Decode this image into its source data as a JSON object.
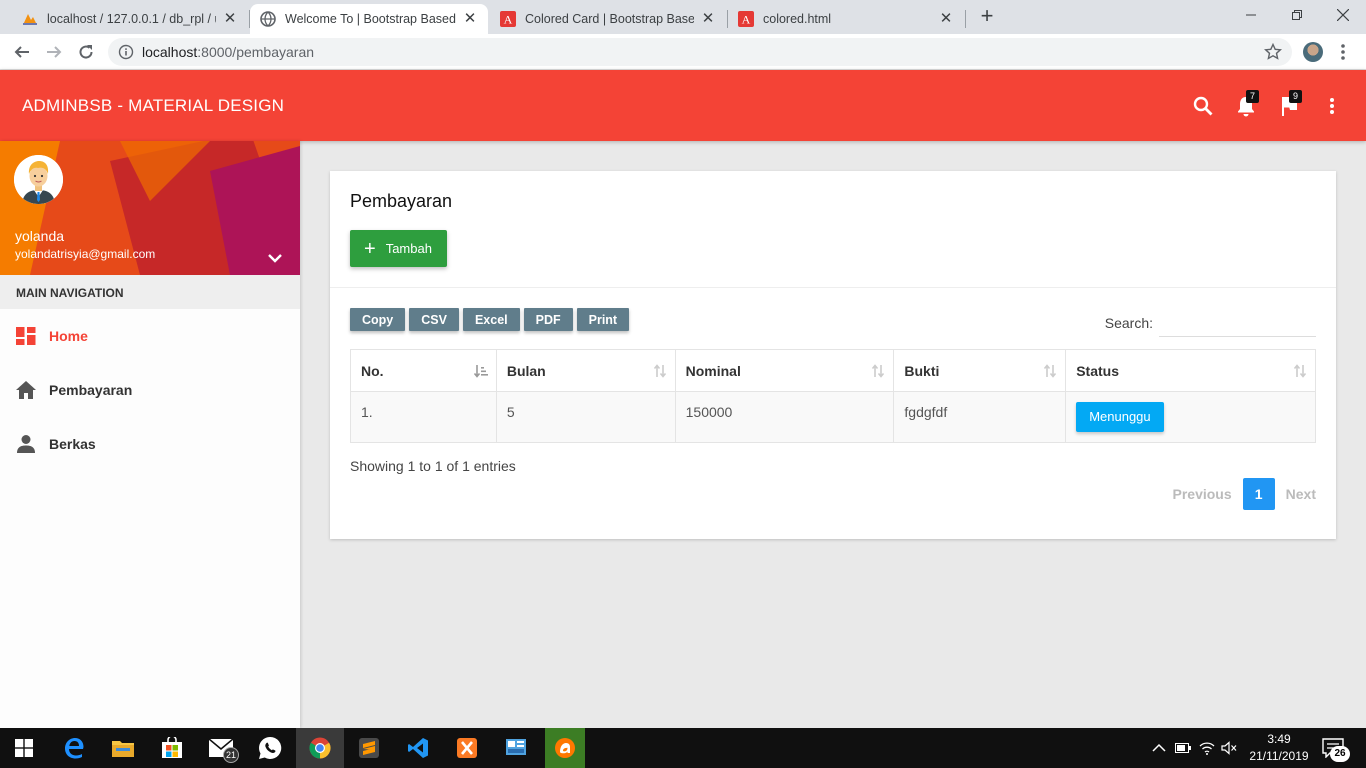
{
  "browser": {
    "tabs": [
      {
        "title": "localhost / 127.0.0.1 / db_rpl / us",
        "icon": "phpmyadmin-icon"
      },
      {
        "title": "Welcome To | Bootstrap Based Ad",
        "icon": "globe-icon"
      },
      {
        "title": "Colored Card | Bootstrap Based A",
        "icon": "adminbsb-icon"
      },
      {
        "title": "colored.html",
        "icon": "adminbsb-icon"
      }
    ],
    "url_host": "localhost",
    "url_path": ":8000/pembayaran"
  },
  "app": {
    "brand": "ADMINBSB - MATERIAL DESIGN",
    "notifications_count": "7",
    "tasks_count": "9",
    "accent": "#f44336"
  },
  "sidebar": {
    "user_name": "yolanda",
    "user_email": "yolandatrisyia@gmail.com",
    "menu_header": "MAIN NAVIGATION",
    "items": [
      {
        "label": "Home",
        "icon": "dashboard-icon",
        "active": true
      },
      {
        "label": "Pembayaran",
        "icon": "home-icon",
        "active": false
      },
      {
        "label": "Berkas",
        "icon": "person-icon",
        "active": false
      }
    ]
  },
  "main": {
    "title": "Pembayaran",
    "add_button": "Tambah",
    "export_buttons": [
      "Copy",
      "CSV",
      "Excel",
      "PDF",
      "Print"
    ],
    "search_label": "Search:",
    "search_value": "",
    "table": {
      "headers": [
        "No.",
        "Bulan",
        "Nominal",
        "Bukti",
        "Status"
      ],
      "rows": [
        {
          "no": "1.",
          "bulan": "5",
          "nominal": "150000",
          "bukti": "fgdgfdf",
          "status": "Menunggu"
        }
      ]
    },
    "info": "Showing 1 to 1 of 1 entries",
    "pagination": {
      "previous": "Previous",
      "current": "1",
      "next": "Next"
    }
  },
  "taskbar": {
    "mail_badge": "21",
    "time": "3:49",
    "date": "21/11/2019",
    "notification_count": "26"
  }
}
